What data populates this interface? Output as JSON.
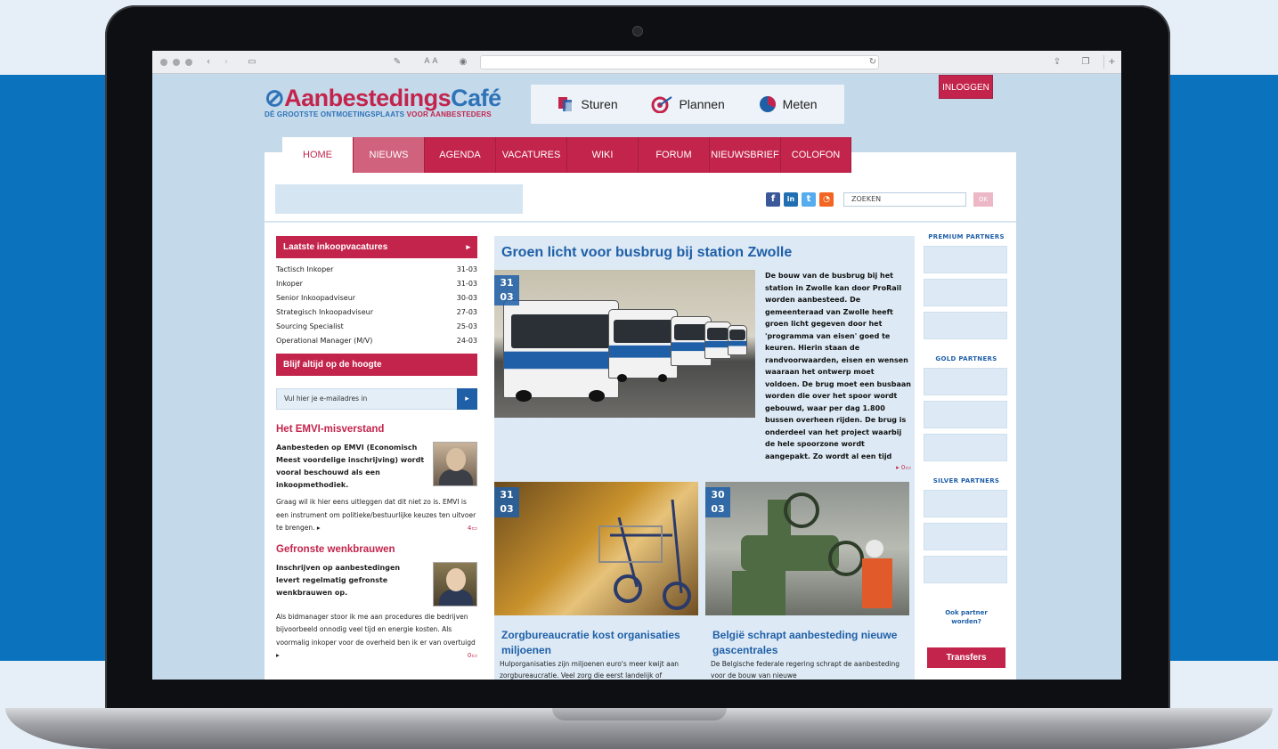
{
  "browser": {
    "reader_aa": "A A"
  },
  "header": {
    "logo_main_a": "Aanbestedings",
    "logo_main_b": "Café",
    "logo_tagline_a": "DÉ GROOTSTE ONTMOETINGSPLAATS ",
    "logo_tagline_b": "VOOR AANBESTEDERS",
    "login_label": "INLOGGEN",
    "topnav": [
      {
        "label": "Sturen",
        "icon": "documents-icon"
      },
      {
        "label": "Plannen",
        "icon": "target-icon"
      },
      {
        "label": "Meten",
        "icon": "pie-chart-icon"
      }
    ]
  },
  "menu": [
    {
      "label": "HOME",
      "width": 80
    },
    {
      "label": "NIEUWS",
      "width": 80
    },
    {
      "label": "AGENDA",
      "width": 80
    },
    {
      "label": "VACATURES",
      "width": 80
    },
    {
      "label": "WIKI",
      "width": 80
    },
    {
      "label": "FORUM",
      "width": 80
    },
    {
      "label": "NIEUWSBRIEF",
      "width": 80
    },
    {
      "label": "COLOFON",
      "width": 80
    }
  ],
  "search": {
    "placeholder": "ZOEKEN",
    "button_label": "OK"
  },
  "vacancies": {
    "title": "Laatste inkoopvacatures",
    "rows": [
      {
        "label": "Tactisch Inkoper",
        "date": "31-03"
      },
      {
        "label": "Inkoper",
        "date": "31-03"
      },
      {
        "label": "Senior Inkoopadviseur",
        "date": "30-03"
      },
      {
        "label": "Strategisch Inkoopadviseur",
        "date": "27-03"
      },
      {
        "label": "Sourcing Specialist",
        "date": "25-03"
      },
      {
        "label": "Operational Manager (M/V)",
        "date": "24-03"
      }
    ]
  },
  "newsletter": {
    "title": "Blijf altijd op de hoogte",
    "placeholder": "Vul hier je e-mailadres in"
  },
  "articles": [
    {
      "title": "Het EMVI-misverstand",
      "lead": "Aanbesteden op EMVI (Economisch Meest voordelige inschrijving) wordt vooral beschouwd als een inkoopmethodiek.",
      "text": "Graag wil ik hier eens uitleggen dat dit niet zo is. EMVI is een instrument om politieke/bestuurlijke keuzes ten uitvoer te brengen.",
      "comments": "4"
    },
    {
      "title": "Gefronste wenkbrauwen",
      "lead": "Inschrijven op aanbestedingen levert regelmatig gefronste wenkbrauwen op.",
      "text": "Als bidmanager stoor ik me aan procedures die bedrijven bijvoorbeeld onnodig veel tijd en energie kosten. Als voormalig inkoper voor de overheid ben ik er van overtuigd",
      "comments": "0"
    }
  ],
  "main": {
    "headline": "Groen licht voor busbrug bij station Zwolle",
    "date_day": "31",
    "date_month": "03",
    "lead": "De bouw van de busbrug bij het station in Zwolle kan door ProRail worden aanbesteed. De gemeenteraad van Zwolle heeft groen licht gegeven door het 'programma van eisen' goed te keuren. Hierin staan de randvoorwaarden, eisen en wensen waaraan het ontwerp moet voldoen. De brug moet een busbaan worden die over het spoor wordt gebouwd, waar per dag 1.800 bussen overheen rijden. De brug is onderdeel van het project waarbij de hele spoorzone wordt aangepakt. Zo wordt al een tijd",
    "comments": "0",
    "sub": [
      {
        "date_day": "31",
        "date_month": "03",
        "title": "Zorgbureaucratie kost organisaties miljoenen",
        "text": "Hulporganisaties zijn miljoenen euro's meer kwijt aan zorgbureaucratie. Veel zorg die eerst landelijk of"
      },
      {
        "date_day": "30",
        "date_month": "03",
        "title": "België schrapt aanbesteding nieuwe gascentrales",
        "text": "De Belgische federale regering schrapt de aanbesteding voor de bouw van nieuwe"
      }
    ]
  },
  "partners": {
    "premium": "PREMIUM PARTNERS",
    "gold": "GOLD PARTNERS",
    "silver": "SILVER PARTNERS",
    "become": "Ook partner worden?",
    "transfers": "Transfers"
  },
  "colors": {
    "brand_red": "#c3244b",
    "brand_blue": "#1f5fa8",
    "page_bg": "#c4d9ea",
    "band": "#0b72bd"
  }
}
